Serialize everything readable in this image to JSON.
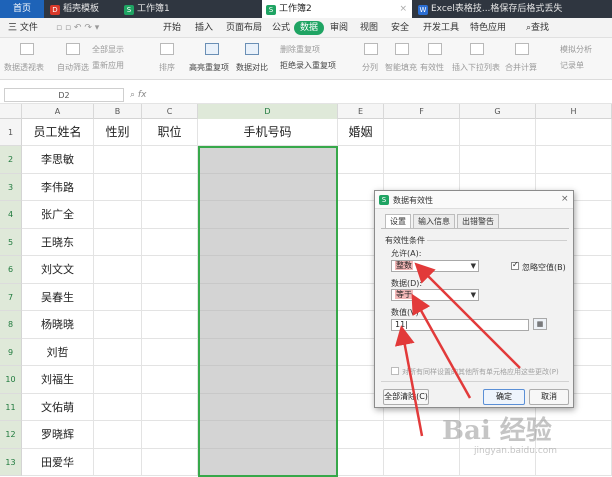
{
  "tabs": [
    {
      "label": "首页"
    },
    {
      "label": "稻壳模板"
    },
    {
      "label": "工作簿1"
    },
    {
      "label": "工作簿2"
    },
    {
      "label": "Excel表格技...格保存后格式丢失"
    }
  ],
  "menu": {
    "file": "三 文件",
    "items": [
      "开始",
      "插入",
      "页面布局",
      "公式",
      "数据",
      "审阅",
      "视图",
      "安全",
      "开发工具",
      "特色应用"
    ],
    "search": "查找"
  },
  "ribbon": {
    "pivot": "数据透视表",
    "autofilter": "自动筛选",
    "show_all": "全部显示",
    "reapply": "重新应用",
    "sort": "排序",
    "highlight_dup": "高亮重复项",
    "compare": "数据对比",
    "remove_dup": "删除重复项",
    "reject_dup": "拒绝录入重复项",
    "split": "分列",
    "smart_fill": "智能填充",
    "validity": "有效性",
    "dropdown": "插入下拉列表",
    "consolidate": "合并计算",
    "simulate": "模拟分析",
    "record": "记录单"
  },
  "formula_bar": {
    "cell_ref": "D2",
    "fx": "fx"
  },
  "sheet": {
    "columns": [
      "A",
      "B",
      "C",
      "D",
      "E",
      "F",
      "G",
      "H"
    ],
    "row_numbers": [
      "1",
      "2",
      "3",
      "4",
      "5",
      "6",
      "7",
      "8",
      "9",
      "10",
      "11",
      "12",
      "13"
    ],
    "headers": [
      "员工姓名",
      "性别",
      "职位",
      "手机号码",
      "婚姻"
    ],
    "names": [
      "李思敏",
      "李伟路",
      "张广全",
      "王晓东",
      "刘文文",
      "吴春生",
      "杨晓晓",
      "刘哲",
      "刘福生",
      "文佑萌",
      "罗晓辉",
      "田爱华"
    ]
  },
  "dialog": {
    "title": "数据有效性",
    "tabs": [
      "设置",
      "输入信息",
      "出错警告"
    ],
    "criteria_label": "有效性条件",
    "allow_label": "允许(A):",
    "allow_value": "整数",
    "ignore_blank": "忽略空值(B)",
    "data_label": "数据(D):",
    "data_value": "等于",
    "value_label": "数值(V)",
    "value_input": "11",
    "apply_all": "对所有同样设置的其他所有单元格应用这些更改(P)",
    "clear_button": "全部清除(C)",
    "ok_button": "确定",
    "cancel_button": "取消"
  },
  "watermark": {
    "brand": "Bai 经验",
    "url": "jingyan.baidu.com"
  },
  "colors": {
    "wps_green": "#1fa463",
    "selection_border": "#37a84a",
    "arrow_red": "#e23a3a",
    "title_blue": "#1e63b8"
  }
}
